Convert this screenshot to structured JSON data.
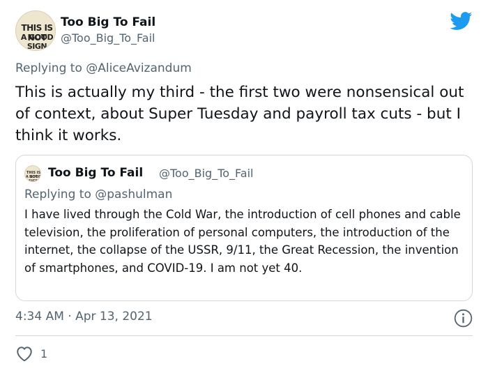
{
  "author": {
    "display_name": "Too Big To Fail",
    "handle": "@Too_Big_To_Fail",
    "avatar_text": [
      "THIS IS NOT",
      "A GOOD SIGN"
    ]
  },
  "brand": {
    "icon": "twitter-bird-icon",
    "color": "#1d9bf0"
  },
  "reply": {
    "prefix": "Replying to",
    "mention": "@AliceAvizandum"
  },
  "tweet": {
    "text": "This is actually my third - the first two were nonsensical out of context, about Super Tuesday and payroll tax cuts - but I think it works."
  },
  "quoted_tweet": {
    "display_name": "Too Big To Fail",
    "handle": "@Too_Big_To_Fail",
    "avatar_text": [
      "THIS IS NOT",
      "A GOOD SIGN"
    ],
    "reply_prefix": "Replying to",
    "reply_mention": "@pashulman",
    "text": "I have lived through the Cold War, the introduction of cell phones and cable television, the proliferation of personal computers, the introduction of the internet, the collapse of the USSR, 9/11, the Great Recession, the invention of smartphones, and COVID-19. I am not yet 40."
  },
  "meta": {
    "timestamp": "4:34 AM · Apr 13, 2021",
    "info_icon": "info-icon"
  },
  "actions": {
    "like_icon": "heart-icon",
    "like_count": "1"
  },
  "colors": {
    "text": "#0f1419",
    "secondary": "#536471",
    "border": "#cfd9de"
  }
}
